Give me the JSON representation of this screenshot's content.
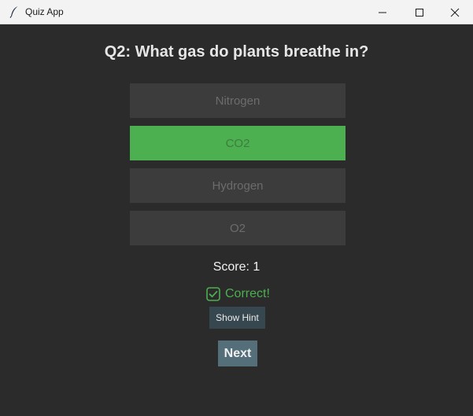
{
  "window": {
    "title": "Quiz App",
    "controls": {
      "minimize": "minimize-icon",
      "maximize": "maximize-icon",
      "close": "close-icon"
    }
  },
  "quiz": {
    "question": "Q2: What gas do plants breathe in?",
    "options": [
      {
        "label": "Nitrogen",
        "state": "disabled"
      },
      {
        "label": "CO2",
        "state": "correct"
      },
      {
        "label": "Hydrogen",
        "state": "disabled"
      },
      {
        "label": "O2",
        "state": "disabled"
      }
    ],
    "score_label": "Score: 1",
    "feedback": {
      "icon": "checkbox-check-icon",
      "text": "Correct!"
    },
    "hint_button": "Show Hint",
    "next_button": "Next"
  },
  "colors": {
    "background": "#2b2b2b",
    "option_bg": "#3c3c3c",
    "correct": "#4caf50",
    "hint_bg": "#37474f",
    "next_bg": "#546e7a"
  }
}
